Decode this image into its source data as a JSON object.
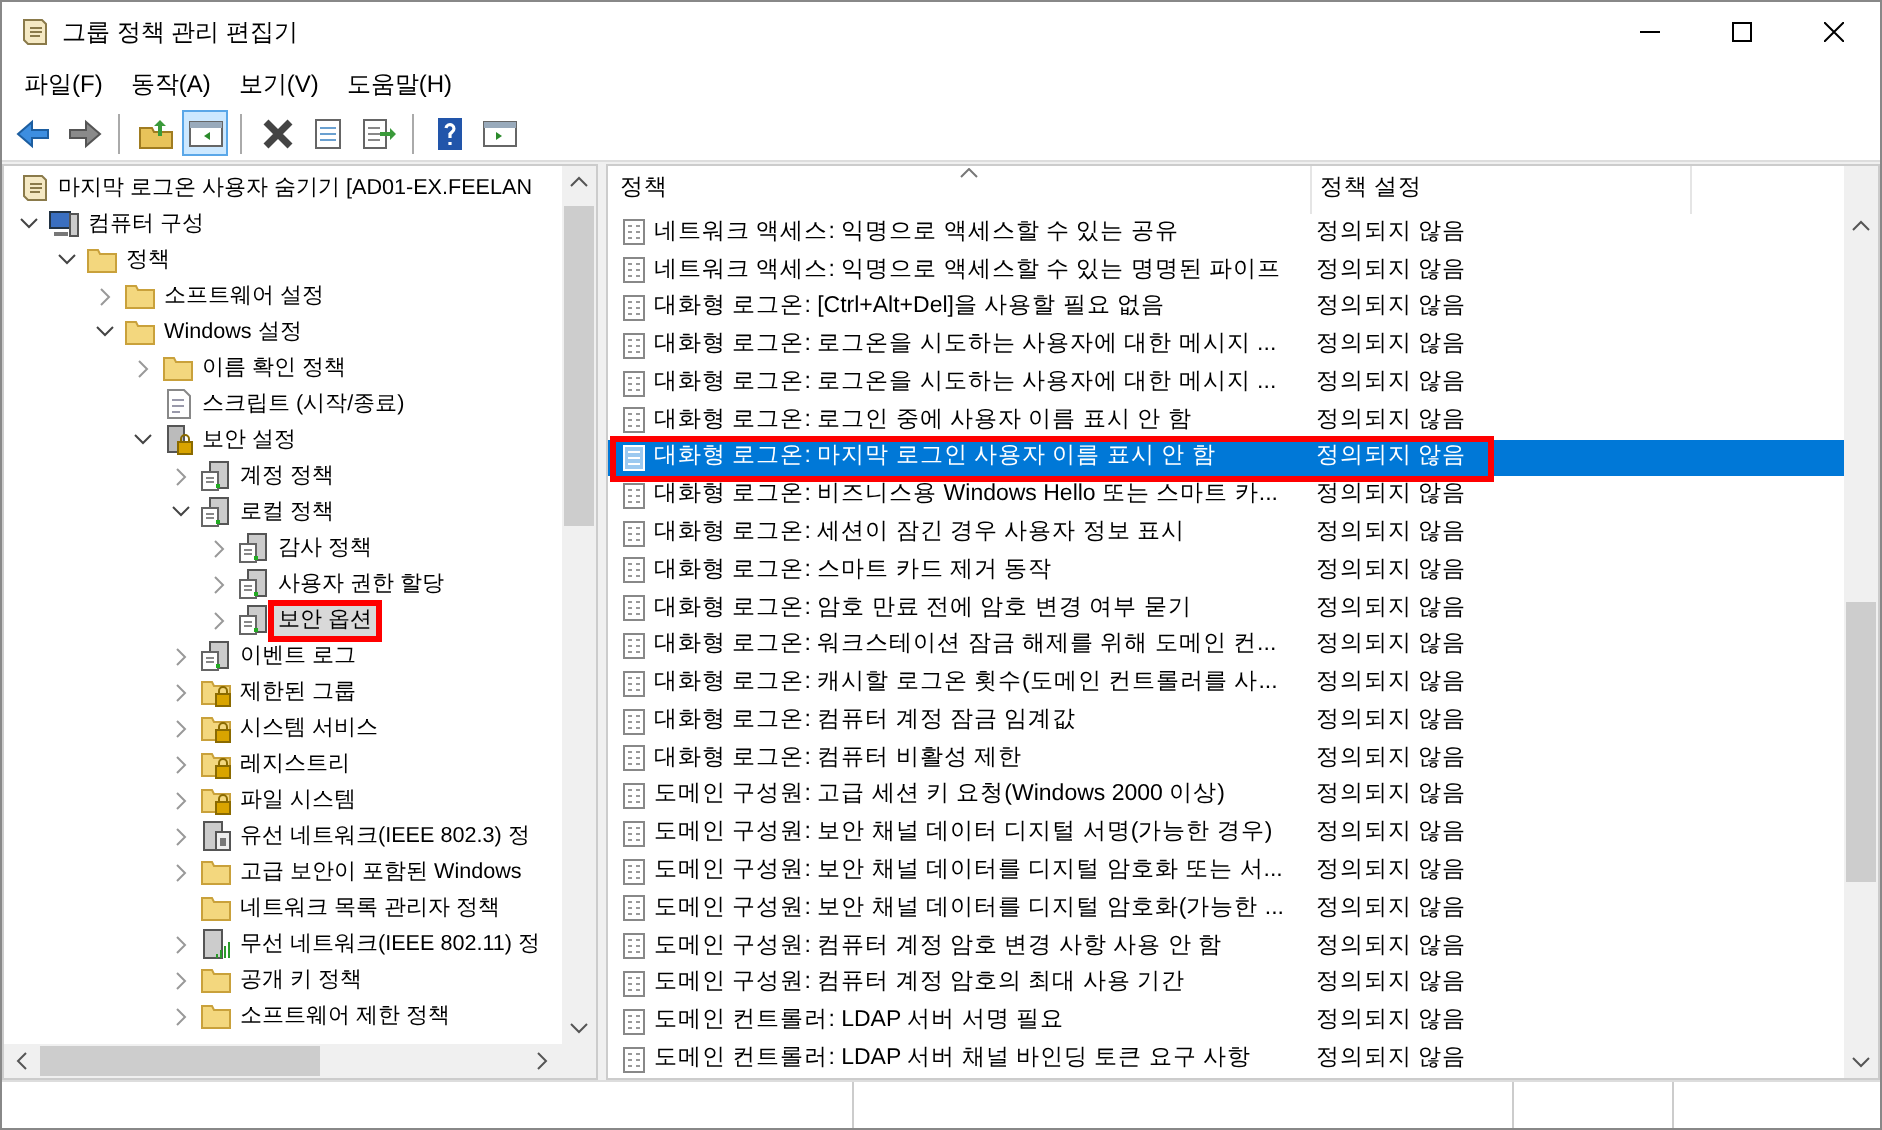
{
  "window": {
    "title": "그룹 정책 관리 편집기"
  },
  "menu": [
    {
      "label": "파일(F)"
    },
    {
      "label": "동작(A)"
    },
    {
      "label": "보기(V)"
    },
    {
      "label": "도움말(H)"
    }
  ],
  "toolbar": [
    {
      "kind": "back",
      "pressed": false
    },
    {
      "kind": "forward",
      "pressed": false
    },
    {
      "kind": "sep"
    },
    {
      "kind": "up",
      "pressed": false
    },
    {
      "kind": "tree",
      "pressed": true
    },
    {
      "kind": "sep"
    },
    {
      "kind": "delete",
      "pressed": false
    },
    {
      "kind": "properties",
      "pressed": false
    },
    {
      "kind": "export",
      "pressed": false
    },
    {
      "kind": "sep"
    },
    {
      "kind": "help",
      "pressed": false
    },
    {
      "kind": "pane",
      "pressed": false
    }
  ],
  "tree": [
    {
      "label": "마지막 로그온 사용자 숨기기 [AD01-EX.FEELAN",
      "kind": "doc",
      "selected": false,
      "red_box": false,
      "children": [
        {
          "label": "컴퓨터 구성",
          "kind": "computer",
          "expandable": true,
          "expanded": true,
          "selected": false,
          "red_box": false,
          "children": [
            {
              "label": "정책",
              "kind": "folder",
              "expandable": true,
              "expanded": true,
              "selected": false,
              "red_box": false,
              "children": [
                {
                  "label": "소프트웨어 설정",
                  "kind": "folder",
                  "expandable": true,
                  "expanded": false,
                  "selected": false,
                  "red_box": false
                },
                {
                  "label": "Windows 설정",
                  "kind": "folder",
                  "expandable": true,
                  "expanded": true,
                  "selected": false,
                  "red_box": false,
                  "children": [
                    {
                      "label": "이름 확인 정책",
                      "kind": "folder",
                      "expandable": true,
                      "expanded": false,
                      "selected": false,
                      "red_box": false
                    },
                    {
                      "label": "스크립트 (시작/종료)",
                      "kind": "script",
                      "expandable": false,
                      "selected": false,
                      "red_box": false
                    },
                    {
                      "label": "보안 설정",
                      "kind": "security",
                      "expandable": true,
                      "expanded": true,
                      "selected": false,
                      "red_box": false,
                      "children": [
                        {
                          "label": "계정 정책",
                          "kind": "policy",
                          "expandable": true,
                          "expanded": false,
                          "selected": false,
                          "red_box": false
                        },
                        {
                          "label": "로컬 정책",
                          "kind": "policy",
                          "expandable": true,
                          "expanded": true,
                          "selected": false,
                          "red_box": false,
                          "children": [
                            {
                              "label": "감사 정책",
                              "kind": "policy",
                              "expandable": true,
                              "expanded": false,
                              "selected": false,
                              "red_box": false
                            },
                            {
                              "label": "사용자 권한 할당",
                              "kind": "policy",
                              "expandable": true,
                              "expanded": false,
                              "selected": false,
                              "red_box": false
                            },
                            {
                              "label": "보안 옵션",
                              "kind": "policy",
                              "expandable": true,
                              "expanded": false,
                              "selected": true,
                              "red_box": true
                            }
                          ]
                        },
                        {
                          "label": "이벤트 로그",
                          "kind": "policy",
                          "expandable": true,
                          "expanded": false,
                          "selected": false,
                          "red_box": false
                        },
                        {
                          "label": "제한된 그룹",
                          "kind": "locked-folder",
                          "expandable": true,
                          "expanded": false,
                          "selected": false,
                          "red_box": false
                        },
                        {
                          "label": "시스템 서비스",
                          "kind": "locked-folder",
                          "expandable": true,
                          "expanded": false,
                          "selected": false,
                          "red_box": false
                        },
                        {
                          "label": "레지스트리",
                          "kind": "locked-folder",
                          "expandable": true,
                          "expanded": false,
                          "selected": false,
                          "red_box": false
                        },
                        {
                          "label": "파일 시스템",
                          "kind": "locked-folder",
                          "expandable": true,
                          "expanded": false,
                          "selected": false,
                          "red_box": false
                        },
                        {
                          "label": "유선 네트워크(IEEE 802.3) 정",
                          "kind": "network",
                          "expandable": true,
                          "expanded": false,
                          "selected": false,
                          "red_box": false
                        },
                        {
                          "label": "고급 보안이 포함된 Windows",
                          "kind": "folder",
                          "expandable": true,
                          "expanded": false,
                          "selected": false,
                          "red_box": false
                        },
                        {
                          "label": "네트워크 목록 관리자 정책",
                          "kind": "folder",
                          "expandable": false,
                          "selected": false,
                          "red_box": false
                        },
                        {
                          "label": "무선 네트워크(IEEE 802.11) 정",
                          "kind": "wireless",
                          "expandable": true,
                          "expanded": false,
                          "selected": false,
                          "red_box": false
                        },
                        {
                          "label": "공개 키 정책",
                          "kind": "folder",
                          "expandable": true,
                          "expanded": false,
                          "selected": false,
                          "red_box": false
                        },
                        {
                          "label": "소프트웨어 제한 정책",
                          "kind": "folder",
                          "expandable": true,
                          "expanded": false,
                          "selected": false,
                          "red_box": false
                        }
                      ]
                    }
                  ]
                }
              ]
            }
          ]
        }
      ]
    }
  ],
  "table": {
    "columns": [
      "정책",
      "정책 설정"
    ],
    "rows": [
      {
        "policy": "네트워크 액세스: 익명으로 액세스할 수 있는 공유",
        "setting": "정의되지 않음",
        "selected": false,
        "red_box": false
      },
      {
        "policy": "네트워크 액세스: 익명으로 액세스할 수 있는 명명된 파이프",
        "setting": "정의되지 않음",
        "selected": false,
        "red_box": false
      },
      {
        "policy": "대화형 로그온: [Ctrl+Alt+Del]을 사용할 필요 없음",
        "setting": "정의되지 않음",
        "selected": false,
        "red_box": false
      },
      {
        "policy": "대화형 로그온: 로그온을 시도하는 사용자에 대한 메시지 ...",
        "setting": "정의되지 않음",
        "selected": false,
        "red_box": false
      },
      {
        "policy": "대화형 로그온: 로그온을 시도하는 사용자에 대한 메시지 ...",
        "setting": "정의되지 않음",
        "selected": false,
        "red_box": false
      },
      {
        "policy": "대화형 로그온: 로그인 중에 사용자 이름 표시 안 함",
        "setting": "정의되지 않음",
        "selected": false,
        "red_box": false
      },
      {
        "policy": "대화형 로그온: 마지막 로그인 사용자 이름 표시 안 함",
        "setting": "정의되지 않음",
        "selected": true,
        "red_box": true
      },
      {
        "policy": "대화형 로그온: 비즈니스용 Windows Hello 또는 스마트 카...",
        "setting": "정의되지 않음",
        "selected": false,
        "red_box": false
      },
      {
        "policy": "대화형 로그온: 세션이 잠긴 경우 사용자 정보 표시",
        "setting": "정의되지 않음",
        "selected": false,
        "red_box": false
      },
      {
        "policy": "대화형 로그온: 스마트 카드 제거 동작",
        "setting": "정의되지 않음",
        "selected": false,
        "red_box": false
      },
      {
        "policy": "대화형 로그온: 암호 만료 전에 암호 변경 여부 묻기",
        "setting": "정의되지 않음",
        "selected": false,
        "red_box": false
      },
      {
        "policy": "대화형 로그온: 워크스테이션 잠금 해제를 위해 도메인 컨...",
        "setting": "정의되지 않음",
        "selected": false,
        "red_box": false
      },
      {
        "policy": "대화형 로그온: 캐시할 로그온 횟수(도메인 컨트롤러를 사...",
        "setting": "정의되지 않음",
        "selected": false,
        "red_box": false
      },
      {
        "policy": "대화형 로그온: 컴퓨터 계정 잠금 임계값",
        "setting": "정의되지 않음",
        "selected": false,
        "red_box": false
      },
      {
        "policy": "대화형 로그온: 컴퓨터 비활성 제한",
        "setting": "정의되지 않음",
        "selected": false,
        "red_box": false
      },
      {
        "policy": "도메인 구성원: 고급 세션 키 요청(Windows 2000 이상)",
        "setting": "정의되지 않음",
        "selected": false,
        "red_box": false
      },
      {
        "policy": "도메인 구성원: 보안 채널 데이터 디지털 서명(가능한 경우)",
        "setting": "정의되지 않음",
        "selected": false,
        "red_box": false
      },
      {
        "policy": "도메인 구성원: 보안 채널 데이터를 디지털 암호화 또는 서...",
        "setting": "정의되지 않음",
        "selected": false,
        "red_box": false
      },
      {
        "policy": "도메인 구성원: 보안 채널 데이터를 디지털 암호화(가능한 ...",
        "setting": "정의되지 않음",
        "selected": false,
        "red_box": false
      },
      {
        "policy": "도메인 구성원: 컴퓨터 계정 암호 변경 사항 사용 안 함",
        "setting": "정의되지 않음",
        "selected": false,
        "red_box": false
      },
      {
        "policy": "도메인 구성원: 컴퓨터 계정 암호의 최대 사용 기간",
        "setting": "정의되지 않음",
        "selected": false,
        "red_box": false
      },
      {
        "policy": "도메인 컨트롤러: LDAP 서버 서명 필요",
        "setting": "정의되지 않음",
        "selected": false,
        "red_box": false
      },
      {
        "policy": "도메인 컨트롤러: LDAP 서버 채널 바인딩 토큰 요구 사항",
        "setting": "정의되지 않음",
        "selected": false,
        "red_box": false
      }
    ]
  }
}
